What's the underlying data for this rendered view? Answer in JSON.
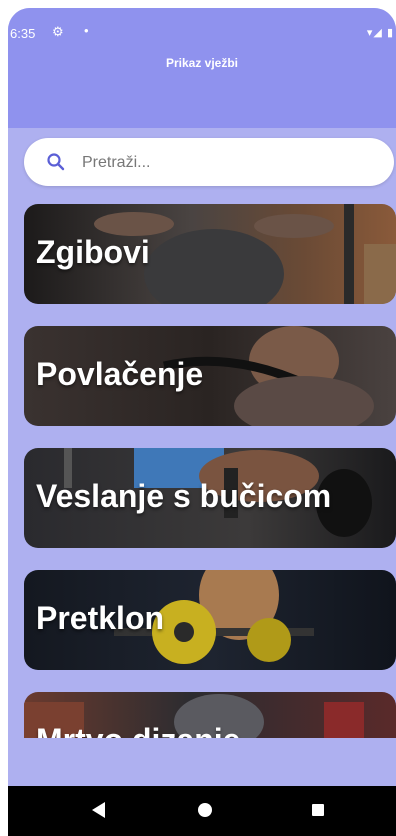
{
  "status_bar": {
    "time": "6:35",
    "gear_icon": "⚙",
    "dot": "•",
    "signal_text": "▾◢ ▮"
  },
  "app_bar": {
    "title": "Prikaz vježbi"
  },
  "search": {
    "placeholder": "Pretraži...",
    "value": ""
  },
  "exercises": [
    {
      "name": "Zgibovi"
    },
    {
      "name": "Povlačenje"
    },
    {
      "name": "Veslanje s bučicom"
    },
    {
      "name": "Pretklon"
    },
    {
      "name": "Mrtvo dizanje"
    }
  ],
  "colors": {
    "app_bar": "#8f92ee",
    "background": "#aeb0f0",
    "search_icon": "#5b5fd6"
  },
  "nav": {
    "back_icon": "back-triangle",
    "home_icon": "home-circle",
    "recent_icon": "recent-square"
  }
}
